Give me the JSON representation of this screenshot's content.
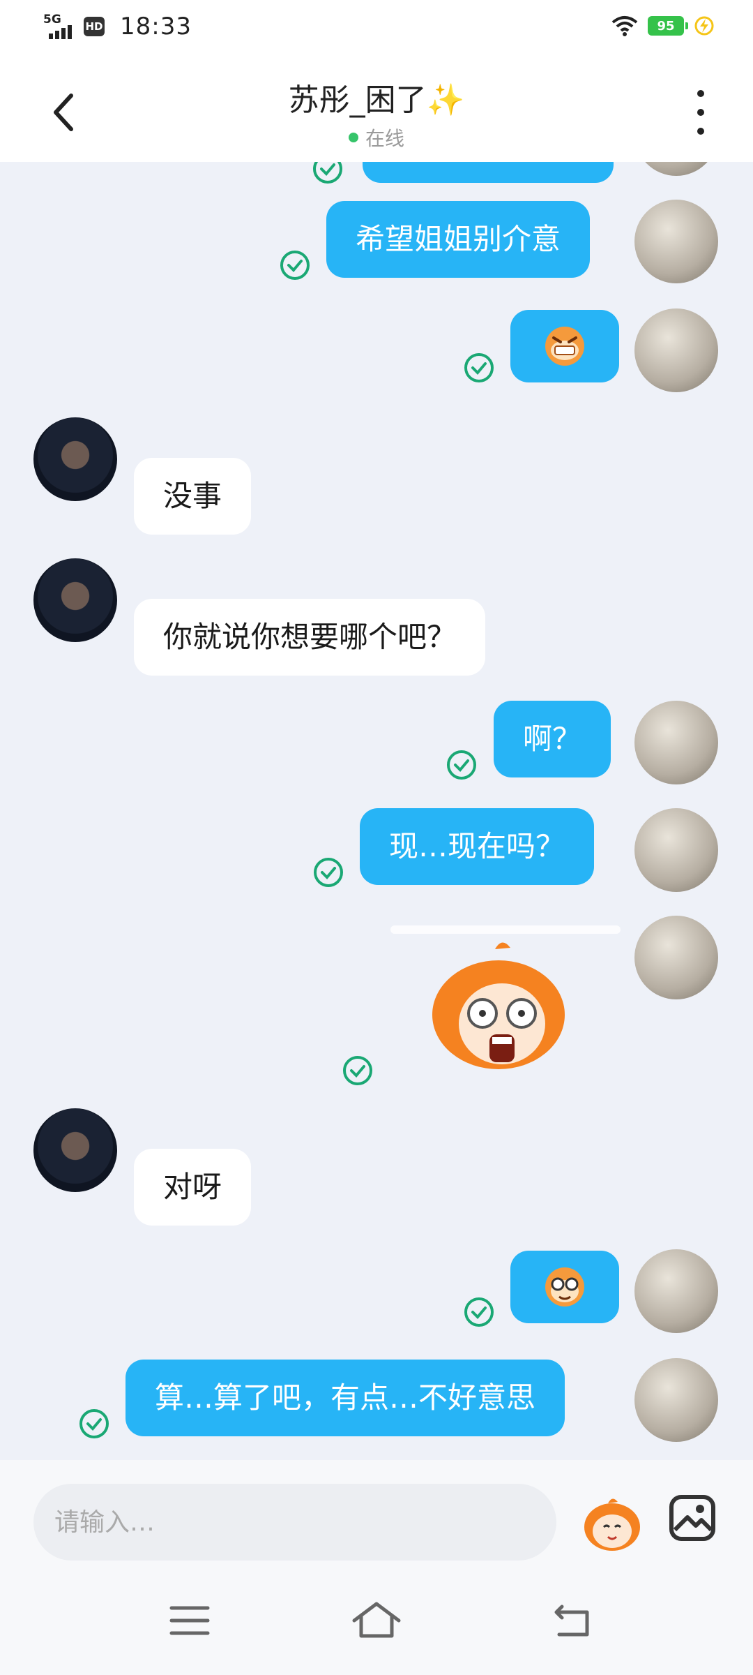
{
  "status_bar": {
    "network": "5G",
    "hd": "HD",
    "time": "18:33",
    "battery": "95",
    "icons": [
      "signal-icon",
      "hd-icon",
      "wifi-icon",
      "battery-icon",
      "charging-icon"
    ]
  },
  "header": {
    "title": "苏彤_困了",
    "title_emoji": "✨",
    "status": "在线",
    "status_color": "#36c46a"
  },
  "messages": [
    {
      "sender": "me",
      "type": "text",
      "text": "希望姐姐别介意"
    },
    {
      "sender": "me",
      "type": "sticker",
      "sticker": "grin-face-sticker"
    },
    {
      "sender": "them",
      "type": "text",
      "text": "没事"
    },
    {
      "sender": "them",
      "type": "text",
      "text": "你就说你想要哪个吧？"
    },
    {
      "sender": "me",
      "type": "text",
      "text": "啊？"
    },
    {
      "sender": "me",
      "type": "text",
      "text": "现…现在吗？"
    },
    {
      "sender": "me",
      "type": "sticker",
      "sticker": "shocked-character-sticker"
    },
    {
      "sender": "them",
      "type": "text",
      "text": "对呀"
    },
    {
      "sender": "me",
      "type": "sticker",
      "sticker": "glasses-face-sticker"
    },
    {
      "sender": "me",
      "type": "text",
      "text": "算…算了吧，有点…不好意思"
    }
  ],
  "input": {
    "placeholder": "请输入…"
  },
  "colors": {
    "my_bubble": "#27b4f6",
    "their_bubble": "#ffffff",
    "read_tick": "#1aa874",
    "background": "#eef1f8"
  }
}
